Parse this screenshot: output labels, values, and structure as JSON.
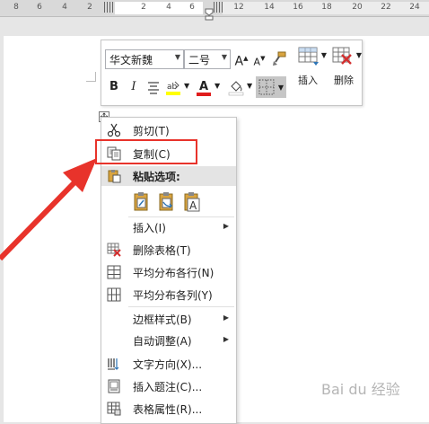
{
  "ruler": {
    "labels": [
      "8",
      "6",
      "4",
      "2",
      "2",
      "4",
      "6",
      "12",
      "14",
      "16",
      "18",
      "20",
      "22",
      "24"
    ]
  },
  "toolbar": {
    "font_name": "华文新魏",
    "font_size": "二号",
    "grow_font": "A",
    "shrink_font": "A",
    "bold": "B",
    "italic": "I",
    "font_color_letter": "A",
    "insert_label": "插入",
    "delete_label": "删除"
  },
  "menu": {
    "cut": "剪切(T)",
    "copy": "复制(C)",
    "paste_options": "粘贴选项:",
    "insert": "插入(I)",
    "delete_table": "删除表格(T)",
    "distribute_rows": "平均分布各行(N)",
    "distribute_cols": "平均分布各列(Y)",
    "border_styles": "边框样式(B)",
    "autofit": "自动调整(A)",
    "text_direction": "文字方向(X)...",
    "insert_caption": "插入题注(C)...",
    "table_properties": "表格属性(R)..."
  },
  "watermark": "Bai du 经验",
  "colors": {
    "highlight_red": "#e8332b",
    "font_color_red": "#e01c1c",
    "highlighter_yellow": "#ffff00"
  }
}
